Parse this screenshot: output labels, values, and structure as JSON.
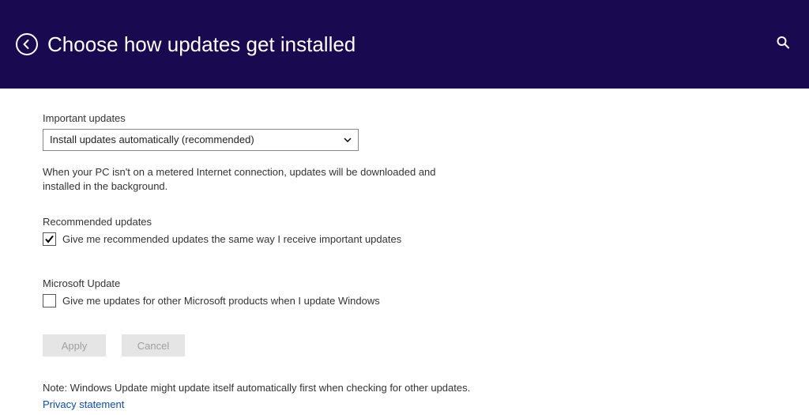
{
  "header": {
    "title": "Choose how updates get installed"
  },
  "important": {
    "label": "Important updates",
    "selected": "Install updates automatically (recommended)",
    "description": "When your PC isn't on a metered Internet connection, updates will be downloaded and installed in the background."
  },
  "recommended": {
    "label": "Recommended updates",
    "checkbox_label": "Give me recommended updates the same way I receive important updates",
    "checked": true
  },
  "microsoft_update": {
    "label": "Microsoft Update",
    "checkbox_label": "Give me updates for other Microsoft products when I update Windows",
    "checked": false
  },
  "buttons": {
    "apply": "Apply",
    "cancel": "Cancel"
  },
  "footer": {
    "note": "Note: Windows Update might update itself automatically first when checking for other updates.",
    "privacy_link": "Privacy statement"
  }
}
